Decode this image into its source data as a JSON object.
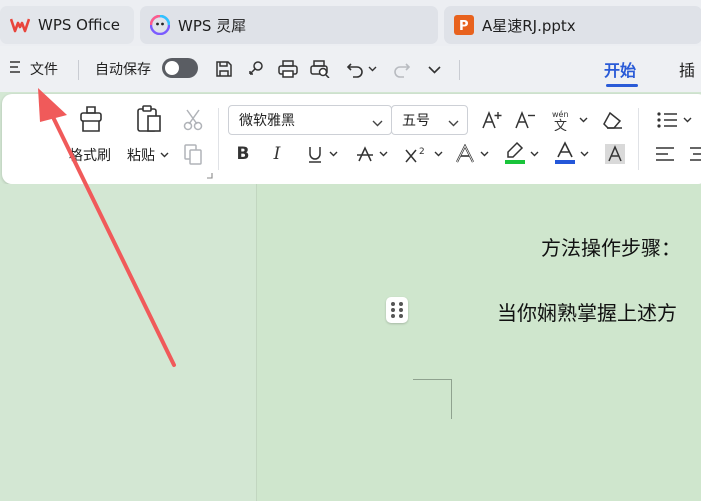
{
  "tabs": [
    {
      "label": "WPS Office"
    },
    {
      "label": "WPS 灵犀"
    },
    {
      "label": "A星速RJ.pptx"
    }
  ],
  "menu": {
    "file_label": "文件",
    "autosave_label": "自动保存",
    "tab_start": "开始",
    "tab_insert": "插"
  },
  "ribbon": {
    "format_brush": "格式刷",
    "paste": "粘贴",
    "font_name": "微软雅黑",
    "font_size": "五号"
  },
  "document": {
    "line1": "方法操作步骤：",
    "line2": "当你娴熟掌握上述方"
  },
  "colors": {
    "accent": "#2a5bd7",
    "wps_red": "#e8453c",
    "ppt_orange": "#e8621e",
    "arrow": "#f05a5a",
    "highlight_green": "#19c43a",
    "font_color_blue": "#2457d9",
    "doc_bg": "#cfe6cd"
  }
}
